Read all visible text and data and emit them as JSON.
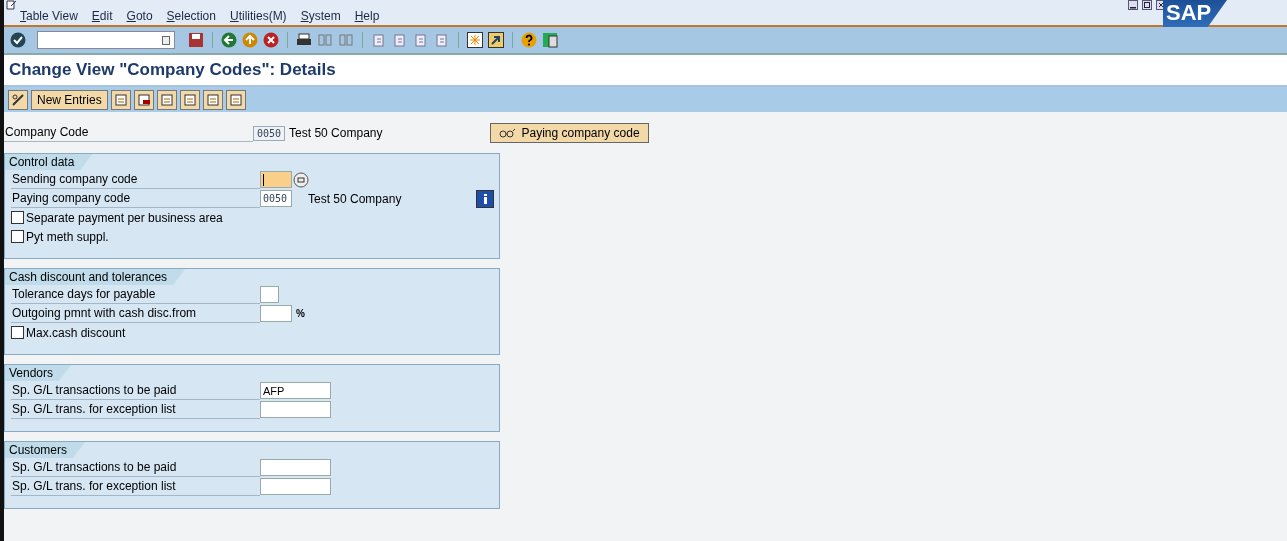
{
  "menu": [
    "Table View",
    "Edit",
    "Goto",
    "Selection",
    "Utilities(M)",
    "System",
    "Help"
  ],
  "logo": "SAP",
  "title": "Change View \"Company Codes\": Details",
  "app_toolbar": {
    "new_entries": "New Entries"
  },
  "header": {
    "label": "Company Code",
    "value": "0050",
    "description": "Test 50 Company",
    "button": "Paying company code"
  },
  "sections": [
    {
      "title": "Control data",
      "rows": [
        {
          "kind": "code",
          "label": "Sending company code",
          "value": "",
          "focused": true,
          "search_help": true
        },
        {
          "kind": "code",
          "label": "Paying company code",
          "value": "0050",
          "focused": false,
          "description": "Test 50 Company",
          "info_button": true
        },
        {
          "kind": "checkbox",
          "label": "Separate payment per business area",
          "checked": false
        },
        {
          "kind": "checkbox",
          "label": "Pyt meth suppl.",
          "checked": false
        }
      ]
    },
    {
      "title": "Cash discount and tolerances",
      "rows": [
        {
          "kind": "tiny",
          "label": "Tolerance days for payable",
          "value": "",
          "focused": false
        },
        {
          "kind": "code",
          "label": "Outgoing pmnt with cash disc.from",
          "value": "",
          "focused": false,
          "unit": "%"
        },
        {
          "kind": "checkbox",
          "label": "Max.cash discount",
          "checked": false
        }
      ]
    },
    {
      "title": "Vendors",
      "rows": [
        {
          "kind": "text",
          "label": "Sp. G/L transactions to be paid",
          "value": "AFP",
          "focused": false
        },
        {
          "kind": "text",
          "label": "Sp. G/L trans. for exception list",
          "value": "",
          "focused": false
        }
      ]
    },
    {
      "title": "Customers",
      "rows": [
        {
          "kind": "text",
          "label": "Sp. G/L transactions to be paid",
          "value": "",
          "focused": false
        },
        {
          "kind": "text",
          "label": "Sp. G/L trans. for exception list",
          "value": "",
          "focused": false
        }
      ]
    }
  ]
}
